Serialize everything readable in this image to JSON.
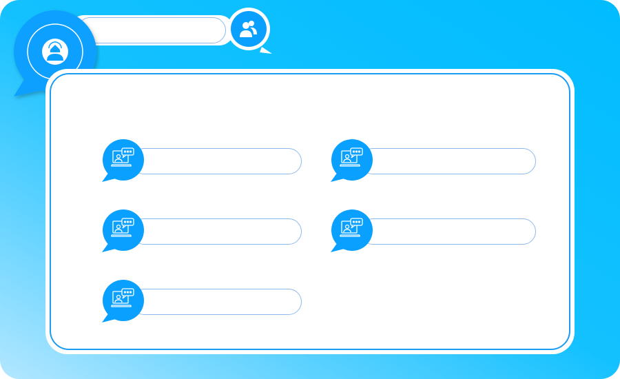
{
  "colors": {
    "background_start": "#00bcff",
    "background_end": "#b3e7ff",
    "accent": "#0aa0ff",
    "panel": "#ffffff",
    "panel_border": "#1a9cf2",
    "pill_border": "#8fb9ee"
  },
  "header": {
    "avatar_icon": "support-agent-icon",
    "group_icon": "users-icon",
    "title_field_value": ""
  },
  "items": [
    {
      "icon": "online-consultation-icon",
      "value": ""
    },
    {
      "icon": "online-consultation-icon",
      "value": ""
    },
    {
      "icon": "online-consultation-icon",
      "value": ""
    },
    {
      "icon": "online-consultation-icon",
      "value": ""
    },
    {
      "icon": "online-consultation-icon",
      "value": ""
    }
  ]
}
